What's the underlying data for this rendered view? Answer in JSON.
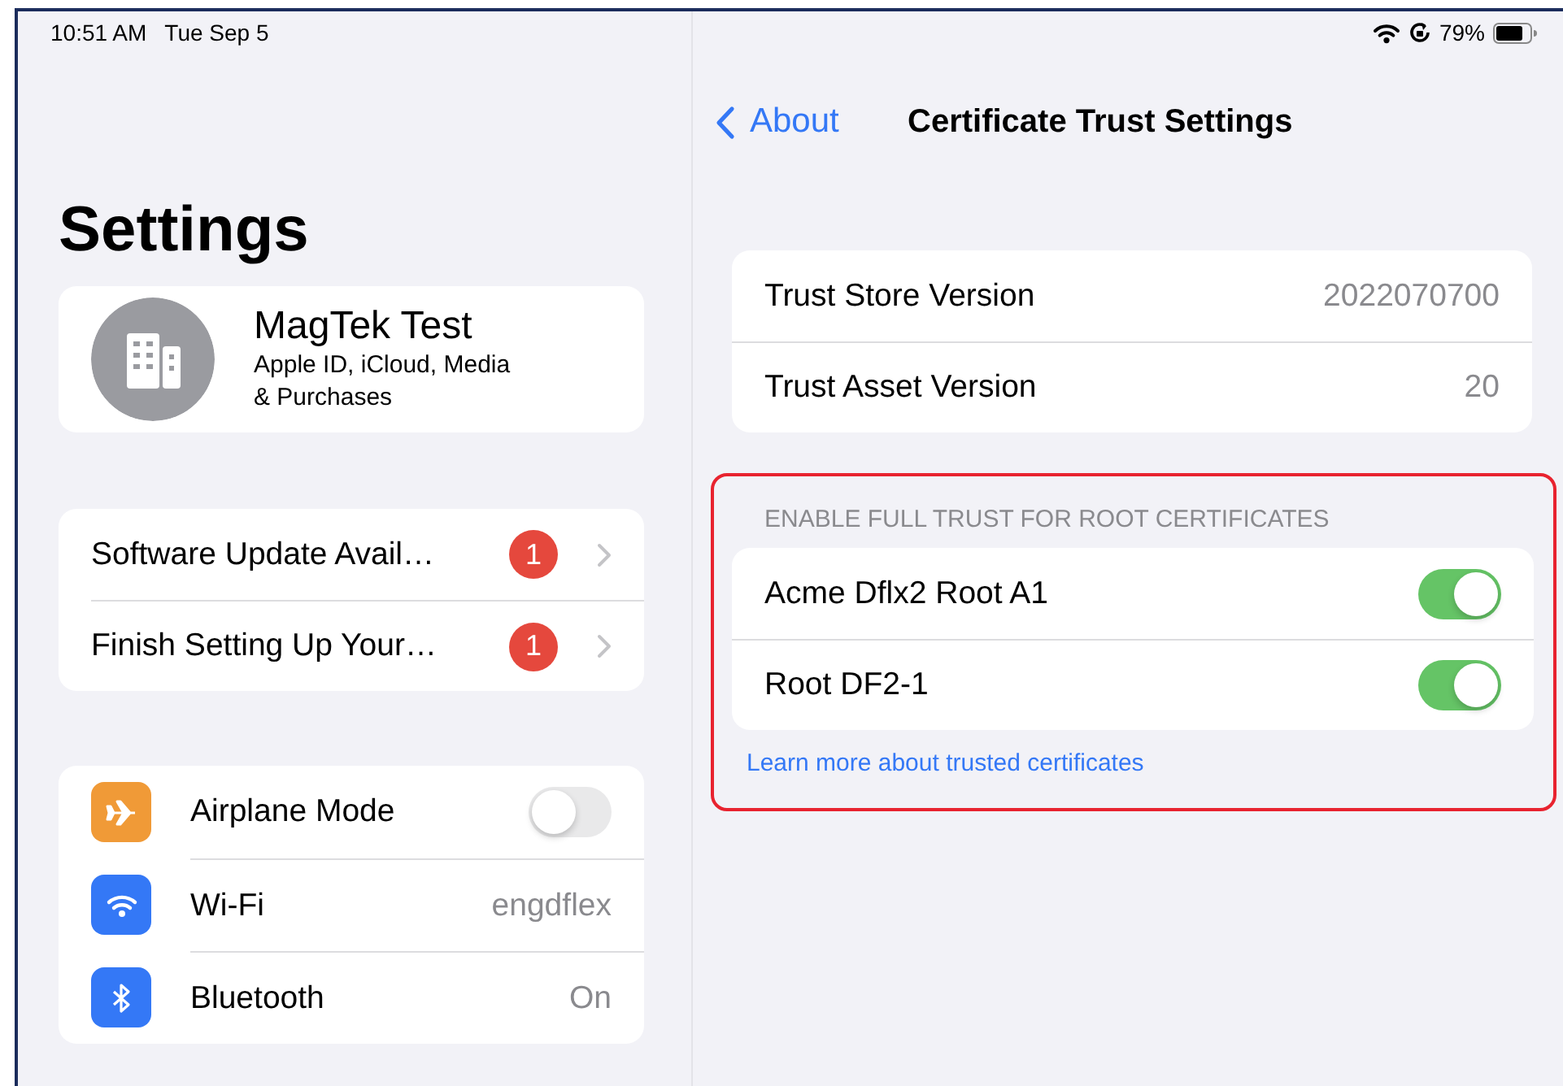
{
  "status_bar": {
    "time": "10:51 AM",
    "date": "Tue Sep 5",
    "battery": "79%"
  },
  "sidebar": {
    "title": "Settings",
    "account": {
      "name": "MagTek Test",
      "subtitle": "Apple ID, iCloud, Media\n& Purchases"
    },
    "alerts": [
      {
        "label": "Software Update Avail…",
        "badge": "1"
      },
      {
        "label": "Finish Setting Up Your…",
        "badge": "1"
      }
    ],
    "items": [
      {
        "kind": "toggle",
        "label": "Airplane Mode",
        "color": "#f09a37",
        "on": false
      },
      {
        "kind": "value",
        "label": "Wi-Fi",
        "color": "#3478f6",
        "value": "engdflex"
      },
      {
        "kind": "value",
        "label": "Bluetooth",
        "color": "#3478f6",
        "value": "On"
      }
    ]
  },
  "detail": {
    "back": "About",
    "title": "Certificate Trust Settings",
    "versions": [
      {
        "label": "Trust Store Version",
        "value": "2022070700"
      },
      {
        "label": "Trust Asset Version",
        "value": "20"
      }
    ],
    "trust_section": {
      "highlighted": true,
      "header": "ENABLE FULL TRUST FOR ROOT CERTIFICATES",
      "certificates": [
        {
          "name": "Acme Dflx2 Root A1",
          "on": true
        },
        {
          "name": "Root DF2-1",
          "on": true
        }
      ],
      "footer_link": "Learn more about trusted certificates"
    }
  }
}
